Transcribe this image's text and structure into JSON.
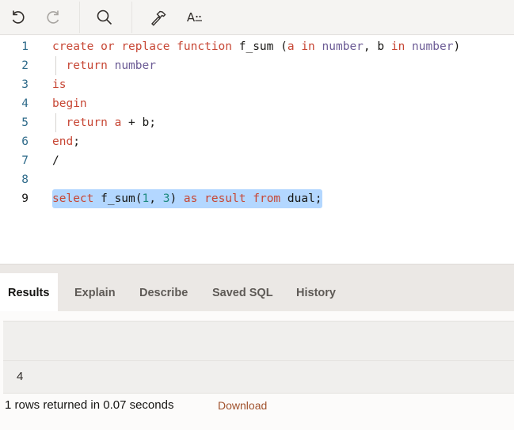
{
  "toolbar": {
    "buttons": [
      {
        "name": "undo",
        "icon": "undo-icon",
        "enabled": true
      },
      {
        "name": "redo",
        "icon": "redo-icon",
        "enabled": false
      },
      {
        "name": "find",
        "icon": "search-icon",
        "enabled": true
      },
      {
        "name": "format",
        "icon": "hammer-icon",
        "enabled": true
      },
      {
        "name": "autocomplete",
        "icon": "text-format-icon",
        "label": "A"
      }
    ]
  },
  "editor": {
    "lines": [
      {
        "number": "1",
        "tokens": [
          {
            "t": "create",
            "c": "kw"
          },
          {
            "t": " "
          },
          {
            "t": "or",
            "c": "kw"
          },
          {
            "t": " "
          },
          {
            "t": "replace",
            "c": "kw"
          },
          {
            "t": " "
          },
          {
            "t": "function",
            "c": "kw"
          },
          {
            "t": " f_sum ("
          },
          {
            "t": "a",
            "c": "kw"
          },
          {
            "t": " "
          },
          {
            "t": "in",
            "c": "kw"
          },
          {
            "t": " "
          },
          {
            "t": "number",
            "c": "ty"
          },
          {
            "t": ", b "
          },
          {
            "t": "in",
            "c": "kw"
          },
          {
            "t": " "
          },
          {
            "t": "number",
            "c": "ty"
          },
          {
            "t": ")"
          }
        ]
      },
      {
        "number": "2",
        "indent": true,
        "tokens": [
          {
            "t": "  "
          },
          {
            "t": "return",
            "c": "kw"
          },
          {
            "t": " "
          },
          {
            "t": "number",
            "c": "ty"
          }
        ]
      },
      {
        "number": "3",
        "tokens": [
          {
            "t": "is",
            "c": "kw"
          }
        ]
      },
      {
        "number": "4",
        "tokens": [
          {
            "t": "begin",
            "c": "kw"
          }
        ]
      },
      {
        "number": "5",
        "indent": true,
        "tokens": [
          {
            "t": "  "
          },
          {
            "t": "return",
            "c": "kw"
          },
          {
            "t": " "
          },
          {
            "t": "a",
            "c": "kw"
          },
          {
            "t": " + b;"
          }
        ]
      },
      {
        "number": "6",
        "tokens": [
          {
            "t": "end",
            "c": "kw"
          },
          {
            "t": ";"
          }
        ]
      },
      {
        "number": "7",
        "tokens": [
          {
            "t": "/"
          }
        ]
      },
      {
        "number": "8",
        "tokens": []
      },
      {
        "number": "9",
        "active": true,
        "selected": true,
        "tokens": [
          {
            "t": "select",
            "c": "kw"
          },
          {
            "t": " f_sum("
          },
          {
            "t": "1",
            "c": "num"
          },
          {
            "t": ", "
          },
          {
            "t": "3",
            "c": "num"
          },
          {
            "t": ") "
          },
          {
            "t": "as",
            "c": "kw"
          },
          {
            "t": " "
          },
          {
            "t": "result",
            "c": "kw"
          },
          {
            "t": " "
          },
          {
            "t": "from",
            "c": "kw"
          },
          {
            "t": " dual;"
          }
        ]
      }
    ]
  },
  "tabs": [
    {
      "label": "Results",
      "active": true
    },
    {
      "label": "Explain"
    },
    {
      "label": "Describe"
    },
    {
      "label": "Saved SQL"
    },
    {
      "label": "History"
    }
  ],
  "results": {
    "columns": [
      ""
    ],
    "rows": [
      [
        "4"
      ]
    ],
    "status": "1 rows returned in 0.07 seconds",
    "download_label": "Download"
  },
  "colors": {
    "keyword": "#c74634",
    "type": "#6b5b95",
    "number": "#1e8a80",
    "selection": "#b3d7ff",
    "link": "#a0522d"
  }
}
